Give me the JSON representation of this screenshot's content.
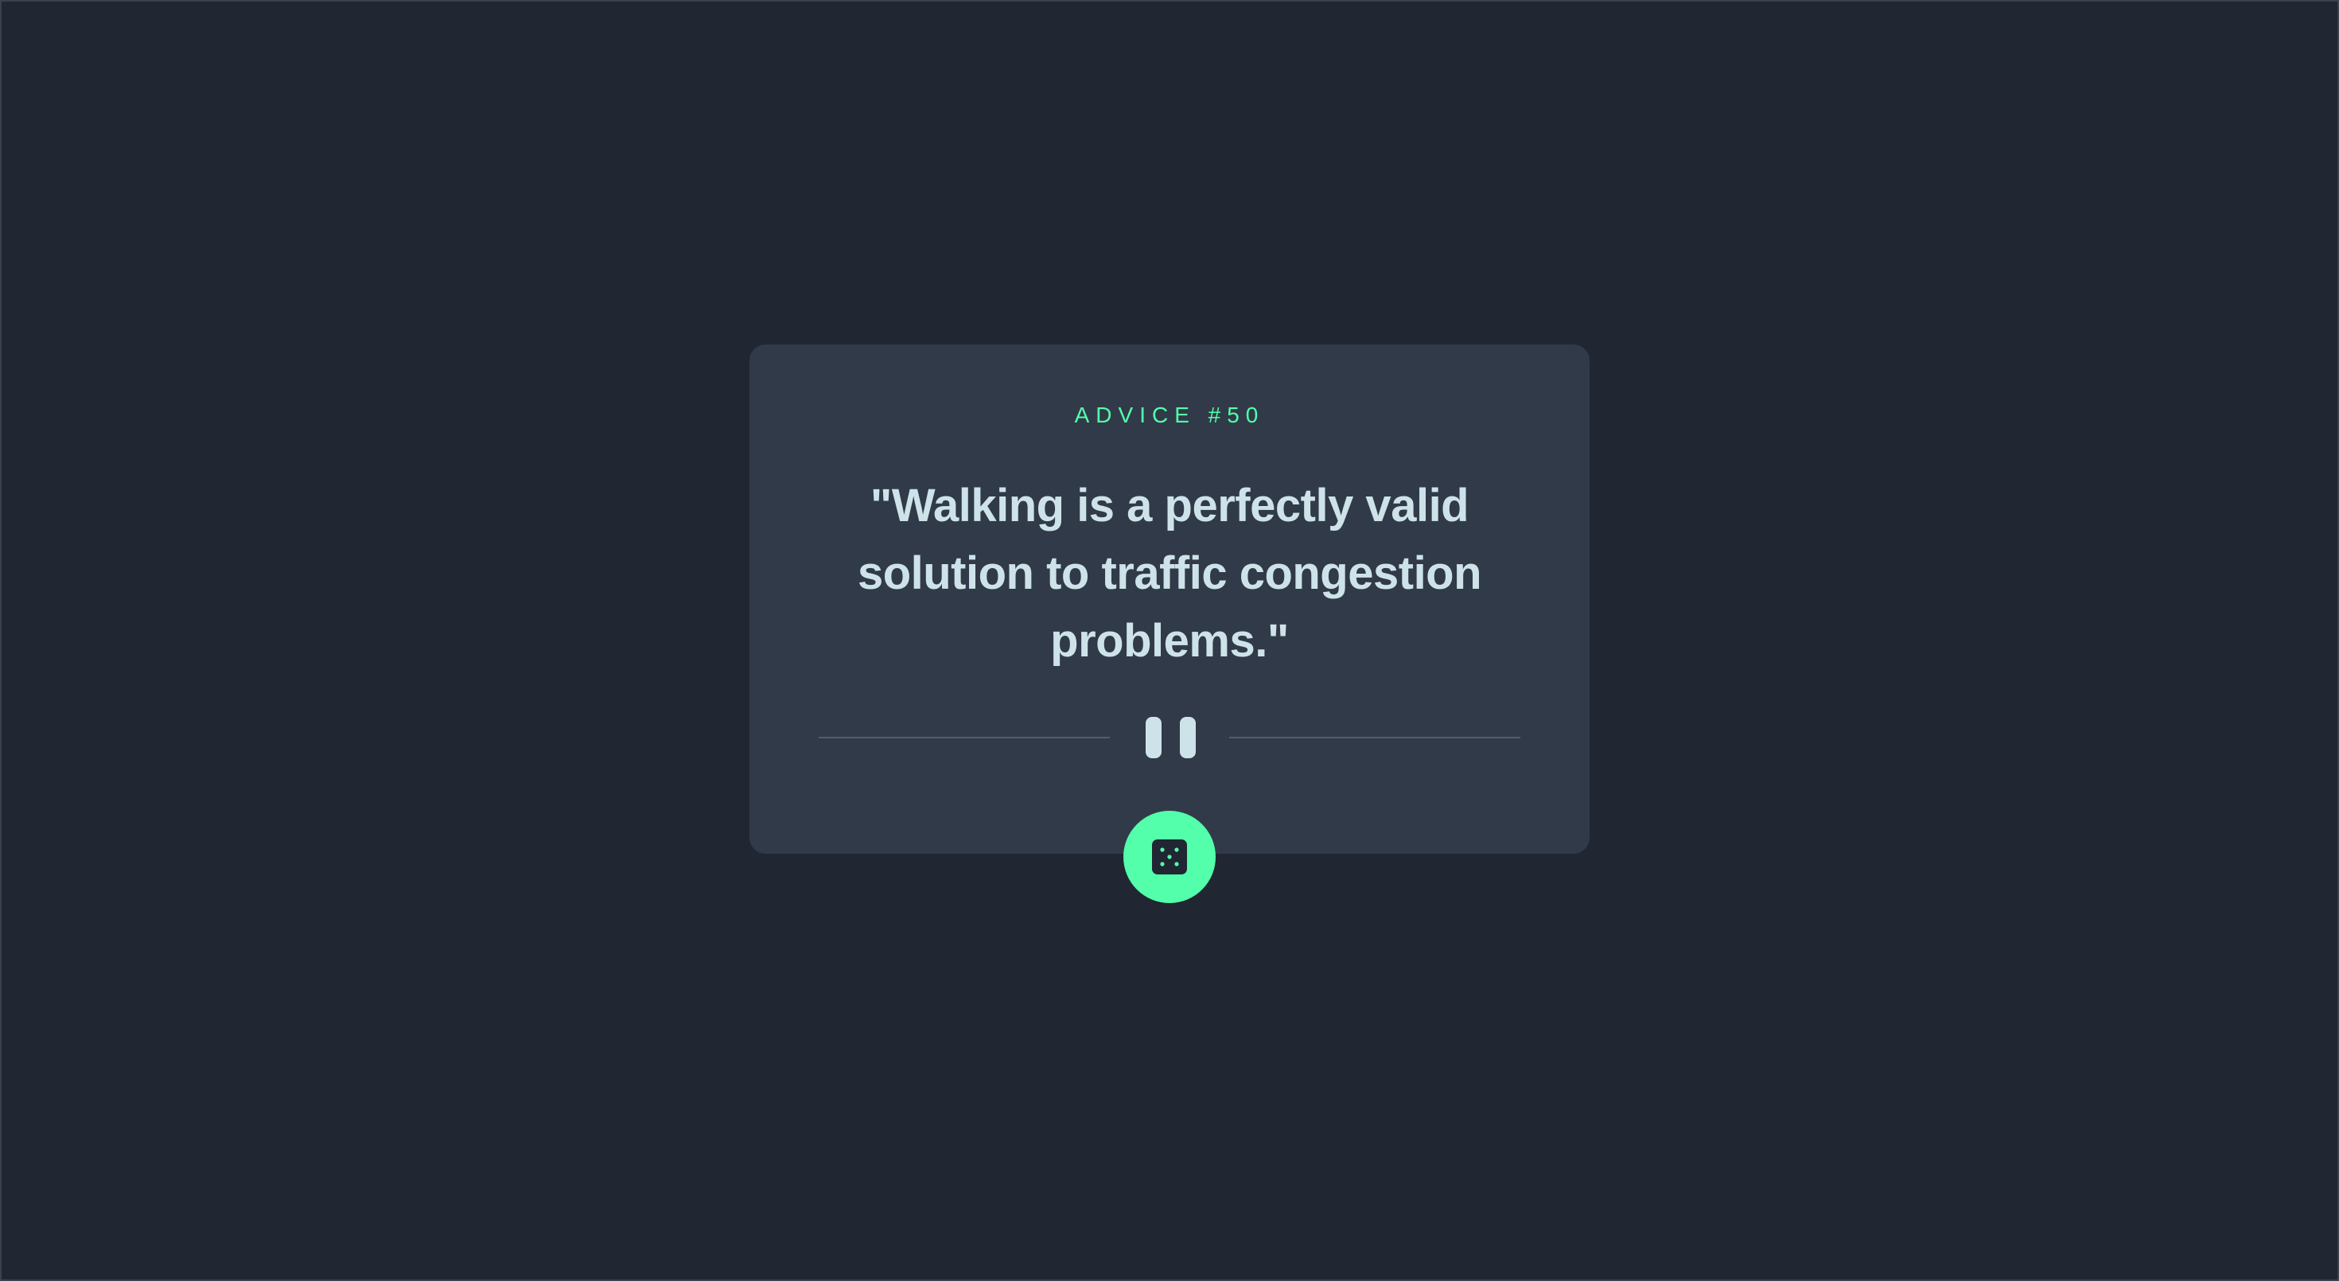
{
  "advice": {
    "label": "ADVICE #50",
    "quote": "\"Walking is a perfectly valid solution to traffic congestion problems.\""
  },
  "icons": {
    "divider": "pause-icon",
    "button": "dice-icon"
  },
  "colors": {
    "background": "#202632",
    "card": "#313a48",
    "accent": "#53ffaa",
    "text": "#cee3e9",
    "divider": "#4f5d74"
  }
}
